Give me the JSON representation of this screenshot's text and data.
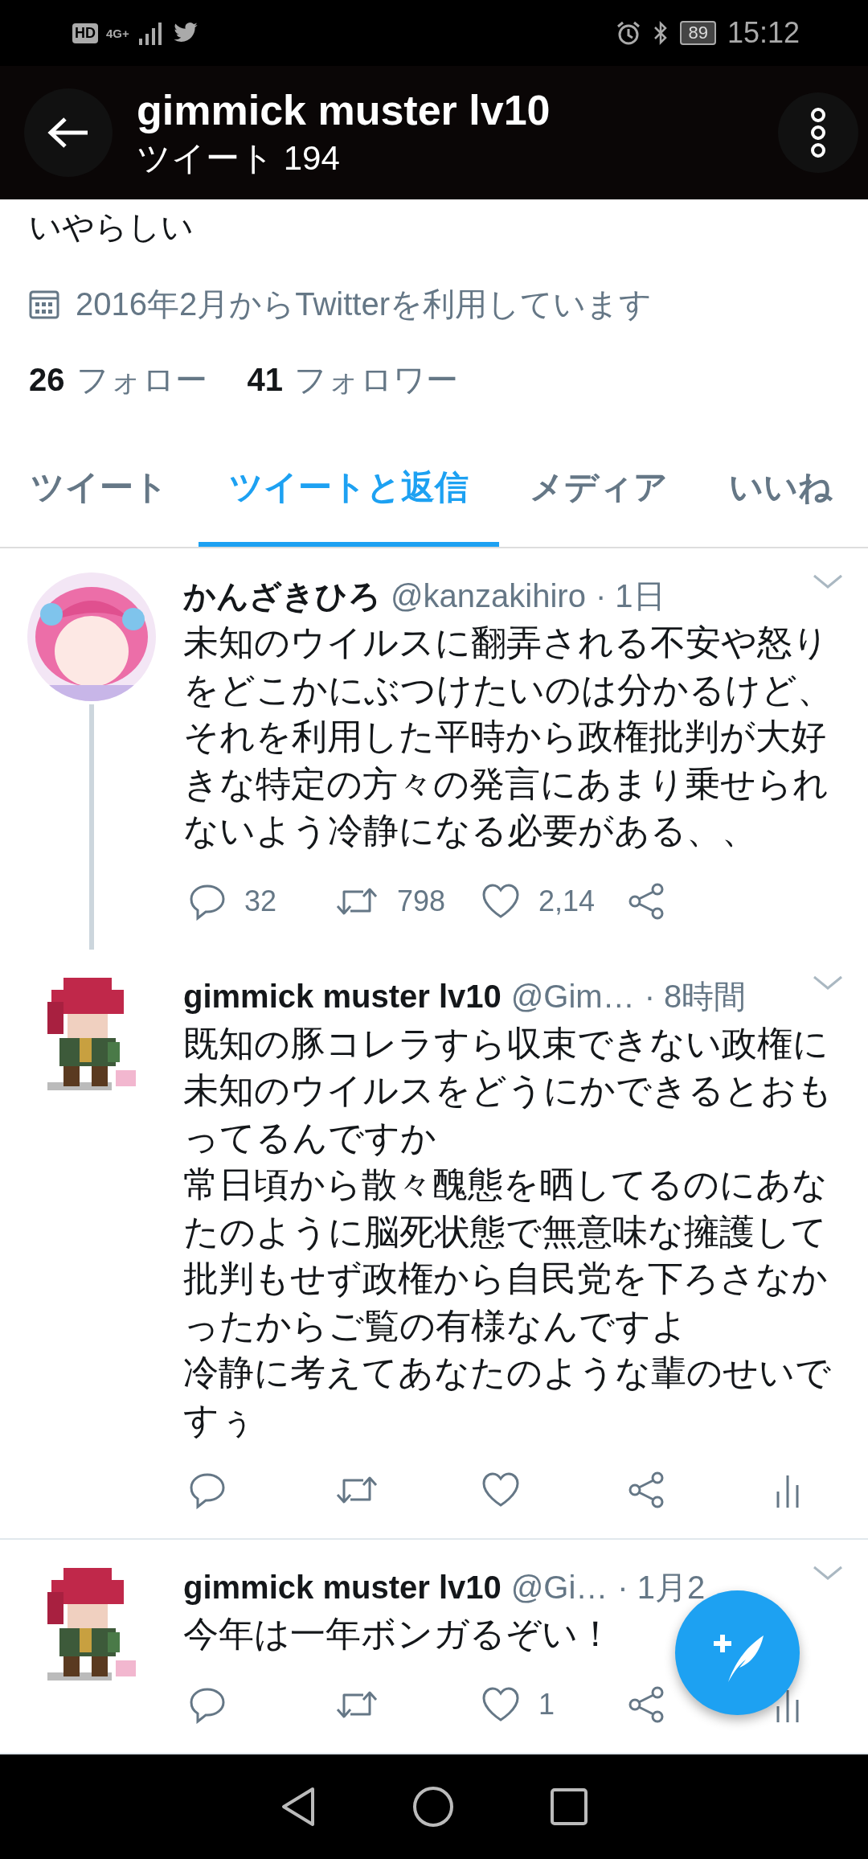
{
  "status_bar": {
    "hd": "HD",
    "network": "4G+",
    "battery": "89",
    "time": "15:12"
  },
  "header": {
    "title": "gimmick muster lv10",
    "subtitle": "ツイート 194"
  },
  "profile": {
    "bio": "いやらしい",
    "joined": "2016年2月からTwitterを利用しています",
    "following": {
      "count": "26",
      "label": "フォロー"
    },
    "followers": {
      "count": "41",
      "label": "フォロワー"
    }
  },
  "tabs": [
    {
      "label": "ツイート",
      "selected": false
    },
    {
      "label": "ツイートと返信",
      "selected": true
    },
    {
      "label": "メディア",
      "selected": false
    },
    {
      "label": "いいね",
      "selected": false
    }
  ],
  "tweets": [
    {
      "avatar": {
        "kind": "round"
      },
      "name": "かんざきひろ",
      "handle": "@kanzakihiro",
      "time": "· 1日",
      "thread_line": true,
      "paragraphs": [
        "未知のウイルスに翻弄される不安や怒りをどこかにぶつけたいのは分かるけど、それを利用した平時から政権批判が大好きな特定の方々の発言にあまり乗せられないよう冷静になる必要がある、、"
      ],
      "actions": [
        {
          "kind": "reply",
          "count": "32"
        },
        {
          "kind": "retweet",
          "count": "798"
        },
        {
          "kind": "like",
          "count": "2,14"
        },
        {
          "kind": "share"
        }
      ]
    },
    {
      "avatar": {
        "kind": "pixel"
      },
      "name": "gimmick muster lv10",
      "handle": "@Gim…",
      "time": "· 8時間",
      "thread_line": false,
      "paragraphs": [
        "既知の豚コレラすら収束できない政権に未知のウイルスをどうにかできるとおもってるんですか",
        "常日頃から散々醜態を晒してるのにあなたのように脳死状態で無意味な擁護して批判もせず政権から自民党を下ろさなかったからご覧の有様なんですよ",
        "冷静に考えてあなたのような輩のせいですぅ"
      ],
      "actions": [
        {
          "kind": "reply"
        },
        {
          "kind": "retweet"
        },
        {
          "kind": "like"
        },
        {
          "kind": "share"
        },
        {
          "kind": "analytics"
        }
      ]
    },
    {
      "avatar": {
        "kind": "pixel"
      },
      "name": "gimmick muster lv10",
      "handle": "@Gi…",
      "time": "· 1月2",
      "thread_line": false,
      "paragraphs": [
        "今年は一年ボンガるぞい！"
      ],
      "actions": [
        {
          "kind": "reply"
        },
        {
          "kind": "retweet"
        },
        {
          "kind": "like",
          "count": "1"
        },
        {
          "kind": "share"
        },
        {
          "kind": "analytics"
        }
      ]
    }
  ]
}
